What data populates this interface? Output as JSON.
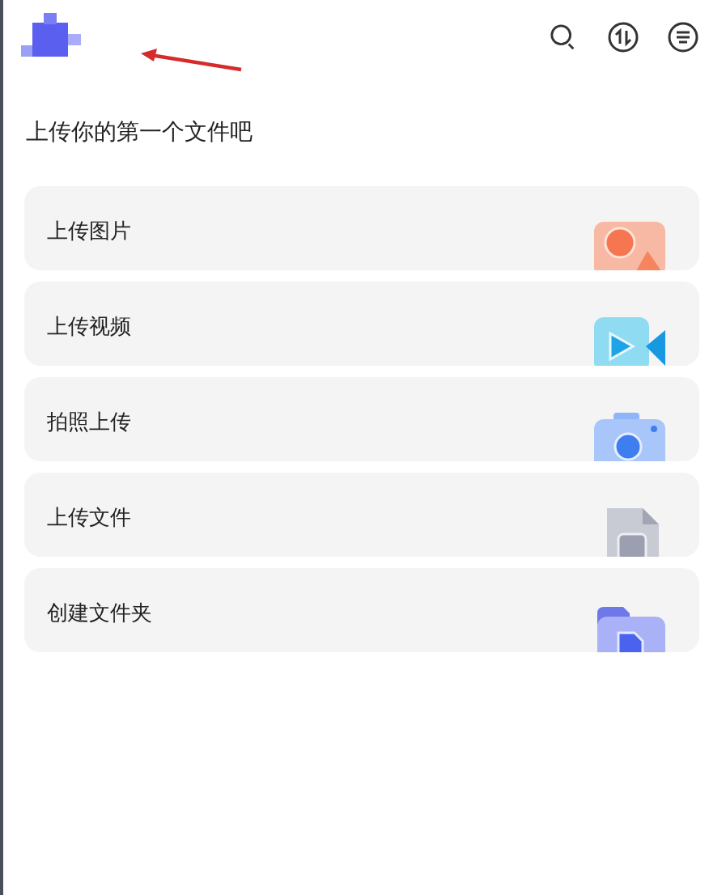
{
  "heading": "上传你的第一个文件吧",
  "actions": [
    {
      "label": "上传图片",
      "kind": "image"
    },
    {
      "label": "上传视频",
      "kind": "video"
    },
    {
      "label": "拍照上传",
      "kind": "camera"
    },
    {
      "label": "上传文件",
      "kind": "file"
    },
    {
      "label": "创建文件夹",
      "kind": "folder"
    }
  ]
}
